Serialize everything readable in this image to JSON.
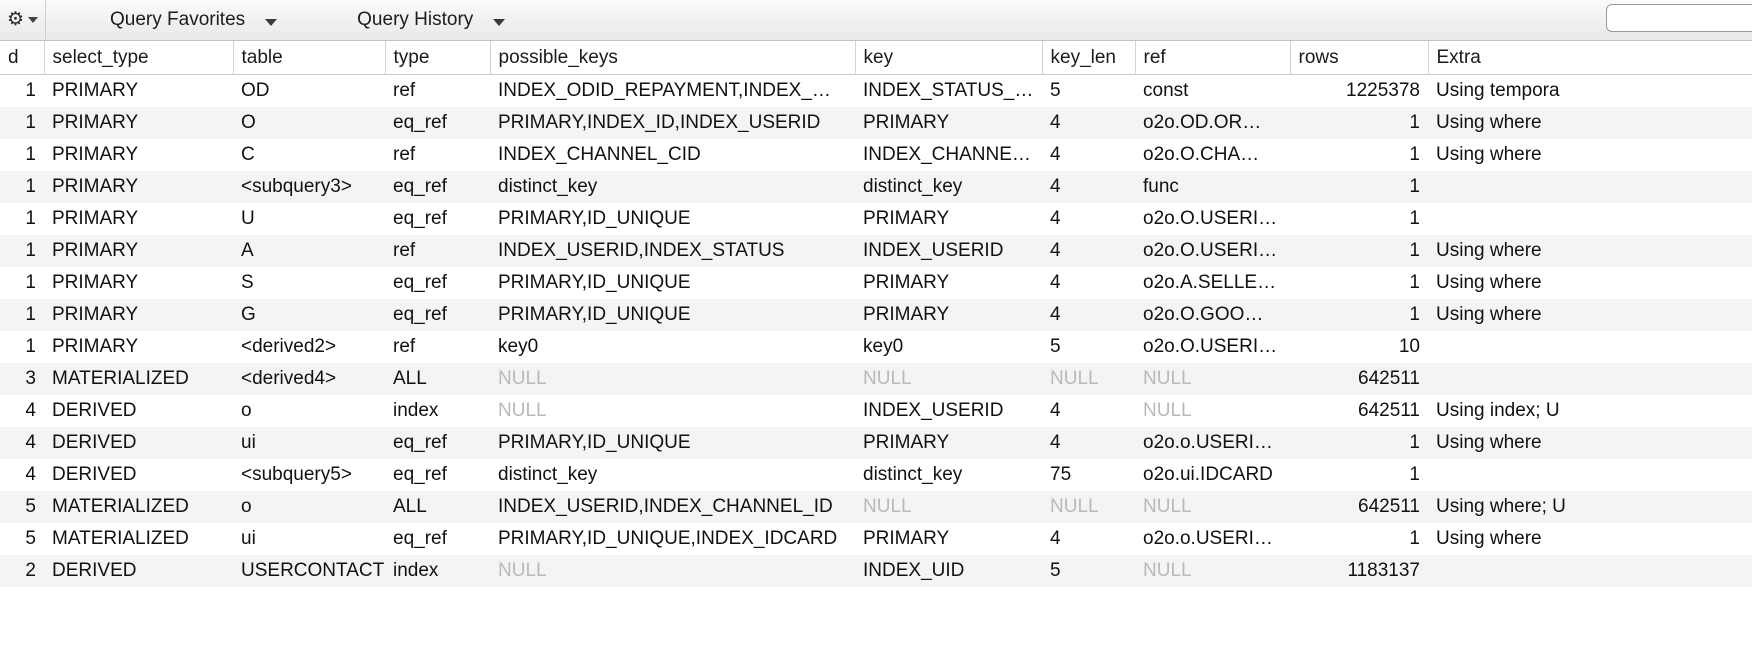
{
  "toolbar": {
    "gear_icon": "gear-icon",
    "gear_caret_icon": "caret-down-icon",
    "query_favorites_label": "Query Favorites",
    "query_favorites_caret_icon": "chevron-down-icon",
    "query_history_label": "Query History",
    "query_history_caret_icon": "chevron-down-icon",
    "search_value": "",
    "search_placeholder": ""
  },
  "grid": {
    "columns": [
      "d",
      "select_type",
      "table",
      "type",
      "possible_keys",
      "key",
      "key_len",
      "ref",
      "rows",
      "Extra"
    ],
    "rows": [
      {
        "id": "1",
        "select_type": "PRIMARY",
        "table": "OD",
        "type": "ref",
        "possible_keys": "INDEX_ODID_REPAYMENT,INDEX_…",
        "key": "INDEX_STATUS_…",
        "key_len": "5",
        "ref": "const",
        "rows": "1225378",
        "extra": "Using tempora"
      },
      {
        "id": "1",
        "select_type": "PRIMARY",
        "table": "O",
        "type": "eq_ref",
        "possible_keys": "PRIMARY,INDEX_ID,INDEX_USERID",
        "key": "PRIMARY",
        "key_len": "4",
        "ref": "o2o.OD.OR…",
        "rows": "1",
        "extra": "Using where"
      },
      {
        "id": "1",
        "select_type": "PRIMARY",
        "table": "C",
        "type": "ref",
        "possible_keys": "INDEX_CHANNEL_CID",
        "key": "INDEX_CHANNE…",
        "key_len": "4",
        "ref": "o2o.O.CHA…",
        "rows": "1",
        "extra": "Using where"
      },
      {
        "id": "1",
        "select_type": "PRIMARY",
        "table": "<subquery3>",
        "type": "eq_ref",
        "possible_keys": "distinct_key",
        "key": "distinct_key",
        "key_len": "4",
        "ref": "func",
        "rows": "1",
        "extra": ""
      },
      {
        "id": "1",
        "select_type": "PRIMARY",
        "table": "U",
        "type": "eq_ref",
        "possible_keys": "PRIMARY,ID_UNIQUE",
        "key": "PRIMARY",
        "key_len": "4",
        "ref": "o2o.O.USERI…",
        "rows": "1",
        "extra": ""
      },
      {
        "id": "1",
        "select_type": "PRIMARY",
        "table": "A",
        "type": "ref",
        "possible_keys": "INDEX_USERID,INDEX_STATUS",
        "key": "INDEX_USERID",
        "key_len": "4",
        "ref": "o2o.O.USERI…",
        "rows": "1",
        "extra": "Using where"
      },
      {
        "id": "1",
        "select_type": "PRIMARY",
        "table": "S",
        "type": "eq_ref",
        "possible_keys": "PRIMARY,ID_UNIQUE",
        "key": "PRIMARY",
        "key_len": "4",
        "ref": "o2o.A.SELLE…",
        "rows": "1",
        "extra": "Using where"
      },
      {
        "id": "1",
        "select_type": "PRIMARY",
        "table": "G",
        "type": "eq_ref",
        "possible_keys": "PRIMARY,ID_UNIQUE",
        "key": "PRIMARY",
        "key_len": "4",
        "ref": "o2o.O.GOO…",
        "rows": "1",
        "extra": "Using where"
      },
      {
        "id": "1",
        "select_type": "PRIMARY",
        "table": "<derived2>",
        "type": "ref",
        "possible_keys": "key0",
        "key": "key0",
        "key_len": "5",
        "ref": "o2o.O.USERI…",
        "rows": "10",
        "extra": ""
      },
      {
        "id": "3",
        "select_type": "MATERIALIZED",
        "table": "<derived4>",
        "type": "ALL",
        "possible_keys": "NULL",
        "key": "NULL",
        "key_len": "NULL",
        "ref": "NULL",
        "rows": "642511",
        "extra": ""
      },
      {
        "id": "4",
        "select_type": "DERIVED",
        "table": "o",
        "type": "index",
        "possible_keys": "NULL",
        "key": "INDEX_USERID",
        "key_len": "4",
        "ref": "NULL",
        "rows": "642511",
        "extra": "Using index; U"
      },
      {
        "id": "4",
        "select_type": "DERIVED",
        "table": "ui",
        "type": "eq_ref",
        "possible_keys": "PRIMARY,ID_UNIQUE",
        "key": "PRIMARY",
        "key_len": "4",
        "ref": "o2o.o.USERI…",
        "rows": "1",
        "extra": "Using where"
      },
      {
        "id": "4",
        "select_type": "DERIVED",
        "table": "<subquery5>",
        "type": "eq_ref",
        "possible_keys": "distinct_key",
        "key": "distinct_key",
        "key_len": "75",
        "ref": "o2o.ui.IDCARD",
        "rows": "1",
        "extra": ""
      },
      {
        "id": "5",
        "select_type": "MATERIALIZED",
        "table": "o",
        "type": "ALL",
        "possible_keys": "INDEX_USERID,INDEX_CHANNEL_ID",
        "key": "NULL",
        "key_len": "NULL",
        "ref": "NULL",
        "rows": "642511",
        "extra": "Using where; U"
      },
      {
        "id": "5",
        "select_type": "MATERIALIZED",
        "table": "ui",
        "type": "eq_ref",
        "possible_keys": "PRIMARY,ID_UNIQUE,INDEX_IDCARD",
        "key": "PRIMARY",
        "key_len": "4",
        "ref": "o2o.o.USERI…",
        "rows": "1",
        "extra": "Using where"
      },
      {
        "id": "2",
        "select_type": "DERIVED",
        "table": "USERCONTACT",
        "type": "index",
        "possible_keys": "NULL",
        "key": "INDEX_UID",
        "key_len": "5",
        "ref": "NULL",
        "rows": "1183137",
        "extra": ""
      }
    ]
  },
  "colors": {
    "row_stripe": "#f4f4f4",
    "null_text": "#b9b9b9",
    "toolbar_bg": "#f0f0f0",
    "text": "#111111"
  }
}
